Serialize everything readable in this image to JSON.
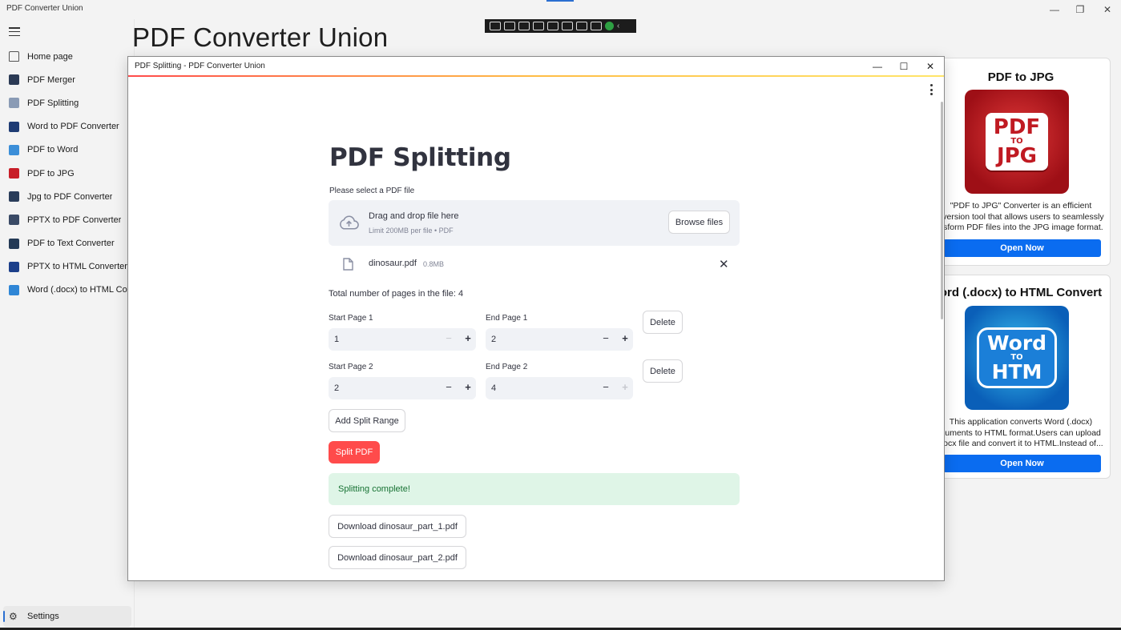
{
  "app": {
    "title": "PDF Converter Union",
    "heading": "PDF Converter Union"
  },
  "sidebar": {
    "items": [
      {
        "label": "Home page",
        "icon": "home-icon",
        "color": "#555555"
      },
      {
        "label": "PDF Merger",
        "icon": "pdf-merger-icon",
        "color": "#2b3a55"
      },
      {
        "label": "PDF Splitting",
        "icon": "pdf-splitting-icon",
        "color": "#8a9bb5"
      },
      {
        "label": "Word to PDF Converter",
        "icon": "word-to-pdf-icon",
        "color": "#1f3c74"
      },
      {
        "label": "PDF to Word",
        "icon": "pdf-to-word-icon",
        "color": "#3b8ed8"
      },
      {
        "label": "PDF to JPG",
        "icon": "pdf-to-jpg-icon",
        "color": "#c81e28"
      },
      {
        "label": "Jpg to PDF Converter",
        "icon": "jpg-to-pdf-icon",
        "color": "#2a3d5a"
      },
      {
        "label": "PPTX to PDF Converter",
        "icon": "pptx-to-pdf-icon",
        "color": "#3a4a66"
      },
      {
        "label": "PDF to Text Converter",
        "icon": "pdf-to-text-icon",
        "color": "#243a56"
      },
      {
        "label": "PPTX to HTML Converter",
        "icon": "pptx-to-html-icon",
        "color": "#1c3f8a"
      },
      {
        "label": "Word (.docx) to HTML Co",
        "icon": "word-to-html-icon",
        "color": "#2f86d6"
      }
    ],
    "settings_label": "Settings"
  },
  "child_window": {
    "title": "PDF Splitting - PDF Converter Union"
  },
  "splitter": {
    "heading": "PDF Splitting",
    "select_label": "Please select a PDF file",
    "dropzone_title": "Drag and drop file here",
    "dropzone_limit": "Limit 200MB per file • PDF",
    "browse_label": "Browse files",
    "file_name": "dinosaur.pdf",
    "file_size": "0.8MB",
    "pages_info": "Total number of pages in the file: 4",
    "ranges": [
      {
        "start_label": "Start Page 1",
        "start_value": "1",
        "end_label": "End Page 1",
        "end_value": "2",
        "delete_label": "Delete"
      },
      {
        "start_label": "Start Page 2",
        "start_value": "2",
        "end_label": "End Page 2",
        "end_value": "4",
        "delete_label": "Delete"
      }
    ],
    "add_range_label": "Add Split Range",
    "split_label": "Split PDF",
    "success_message": "Splitting complete!",
    "downloads": [
      "Download dinosaur_part_1.pdf",
      "Download dinosaur_part_2.pdf"
    ]
  },
  "promos": [
    {
      "title": "PDF to JPG",
      "image_top": "PDF",
      "image_mid": "TO",
      "image_bottom": "JPG",
      "desc_lines": [
        "\"PDF to JPG\" Converter is an efficient",
        "nversion tool that allows users to seamlessly",
        "nsform PDF files into the JPG image format."
      ],
      "button": "Open Now"
    },
    {
      "title": "ord (.docx) to HTML Convert",
      "image_top": "Word",
      "image_mid": "TO",
      "image_bottom": "HTM",
      "desc_lines": [
        "This application converts Word (.docx)",
        "cuments to HTML format.Users can upload",
        "docx file and convert it to HTML.Instead of..."
      ],
      "button": "Open Now"
    }
  ],
  "colors": {
    "accent_red": "#ff4b4b",
    "promo_button": "#0a6cf0",
    "success_bg": "#dff5e7",
    "success_text": "#177233"
  }
}
